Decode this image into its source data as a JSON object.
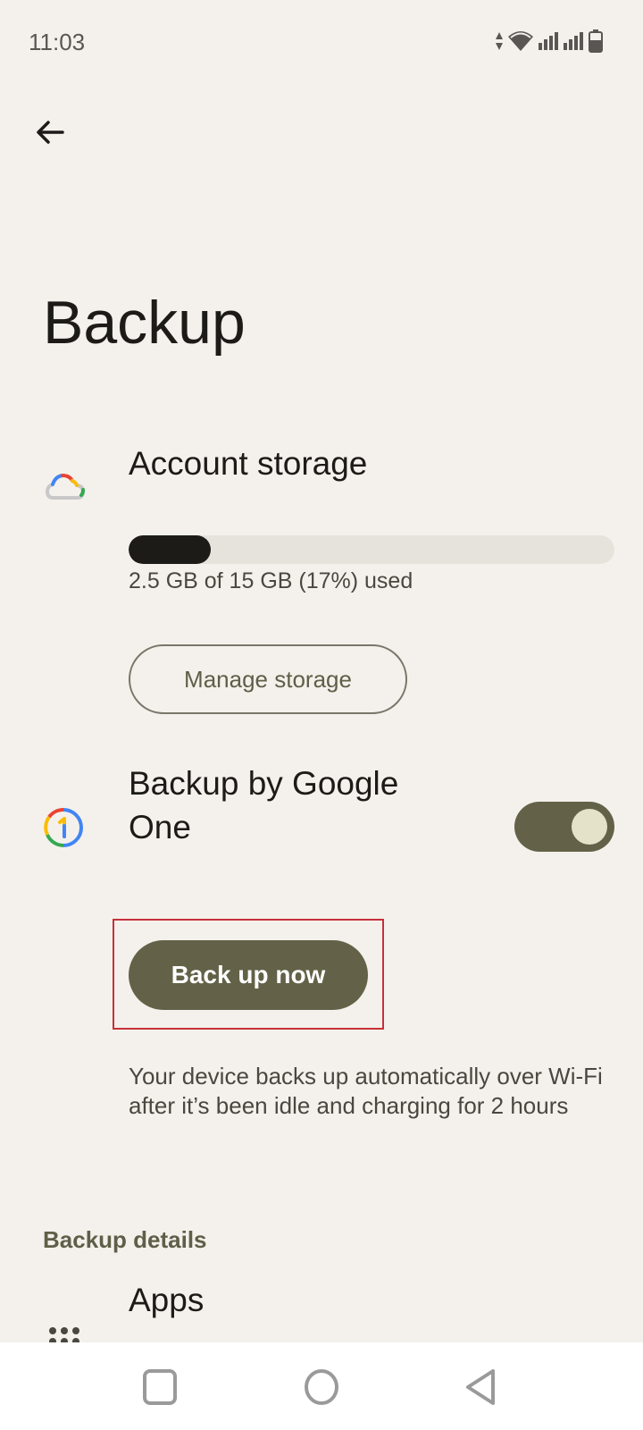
{
  "status_bar": {
    "time": "11:03",
    "icons": [
      "data-arrows-icon",
      "wifi-icon",
      "signal-icon",
      "signal-icon",
      "battery-icon"
    ]
  },
  "header": {
    "back_icon": "arrow-left-icon",
    "title": "Backup"
  },
  "account_storage": {
    "icon": "google-cloud-icon",
    "title": "Account storage",
    "used_fraction": 0.17,
    "usage_text": "2.5 GB of 15 GB (17%) used",
    "manage_button": "Manage storage"
  },
  "google_one_backup": {
    "icon": "google-one-icon",
    "title": "Backup by Google One",
    "toggle_on": true,
    "backup_now_button": "Back up now",
    "description": "Your device backs up automatically over Wi-Fi after it’s been idle and charging for 2 hours"
  },
  "backup_details": {
    "section_label": "Backup details",
    "items": [
      {
        "icon": "apps-grid-icon",
        "label": "Apps"
      }
    ]
  },
  "nav_bar": {
    "buttons": [
      "recents-icon",
      "home-icon",
      "back-icon"
    ]
  },
  "colors": {
    "background": "#f4f1ec",
    "accent": "#636248",
    "highlight_border": "#c8303a"
  }
}
